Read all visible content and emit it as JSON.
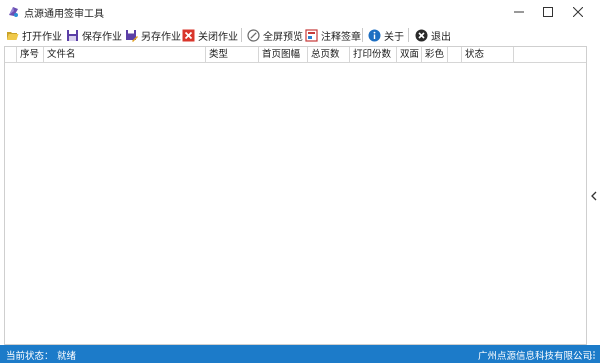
{
  "window": {
    "title": "点源通用签审工具",
    "icons": {
      "app": "app-logo-icon",
      "minimize": "minimize-icon",
      "maximize": "maximize-icon",
      "close": "close-icon"
    }
  },
  "toolbar": {
    "items": [
      {
        "label": "打开作业",
        "icon": "open-folder-icon"
      },
      {
        "label": "保存作业",
        "icon": "save-icon"
      },
      {
        "label": "另存作业",
        "icon": "save-as-icon"
      },
      {
        "label": "关闭作业",
        "icon": "close-red-icon"
      },
      {
        "label": "全屏预览",
        "icon": "fullscreen-preview-icon"
      },
      {
        "label": "注释签章",
        "icon": "annotate-stamp-icon"
      },
      {
        "label": "关于",
        "icon": "info-icon"
      },
      {
        "label": "退出",
        "icon": "exit-icon"
      }
    ]
  },
  "table": {
    "columns": [
      "",
      "序号",
      "文件名",
      "类型",
      "首页图幅",
      "总页数",
      "打印份数",
      "双面",
      "彩色",
      "",
      "状态"
    ],
    "rows": []
  },
  "status": {
    "label": "当前状态：",
    "value": "就绪",
    "company": "广州点源信息科技有限公司"
  },
  "colors": {
    "statusbar_bg": "#1c7bc9",
    "close_red": "#d9362b",
    "info_blue": "#1e6fc2",
    "save_purple": "#5b3fa6"
  }
}
